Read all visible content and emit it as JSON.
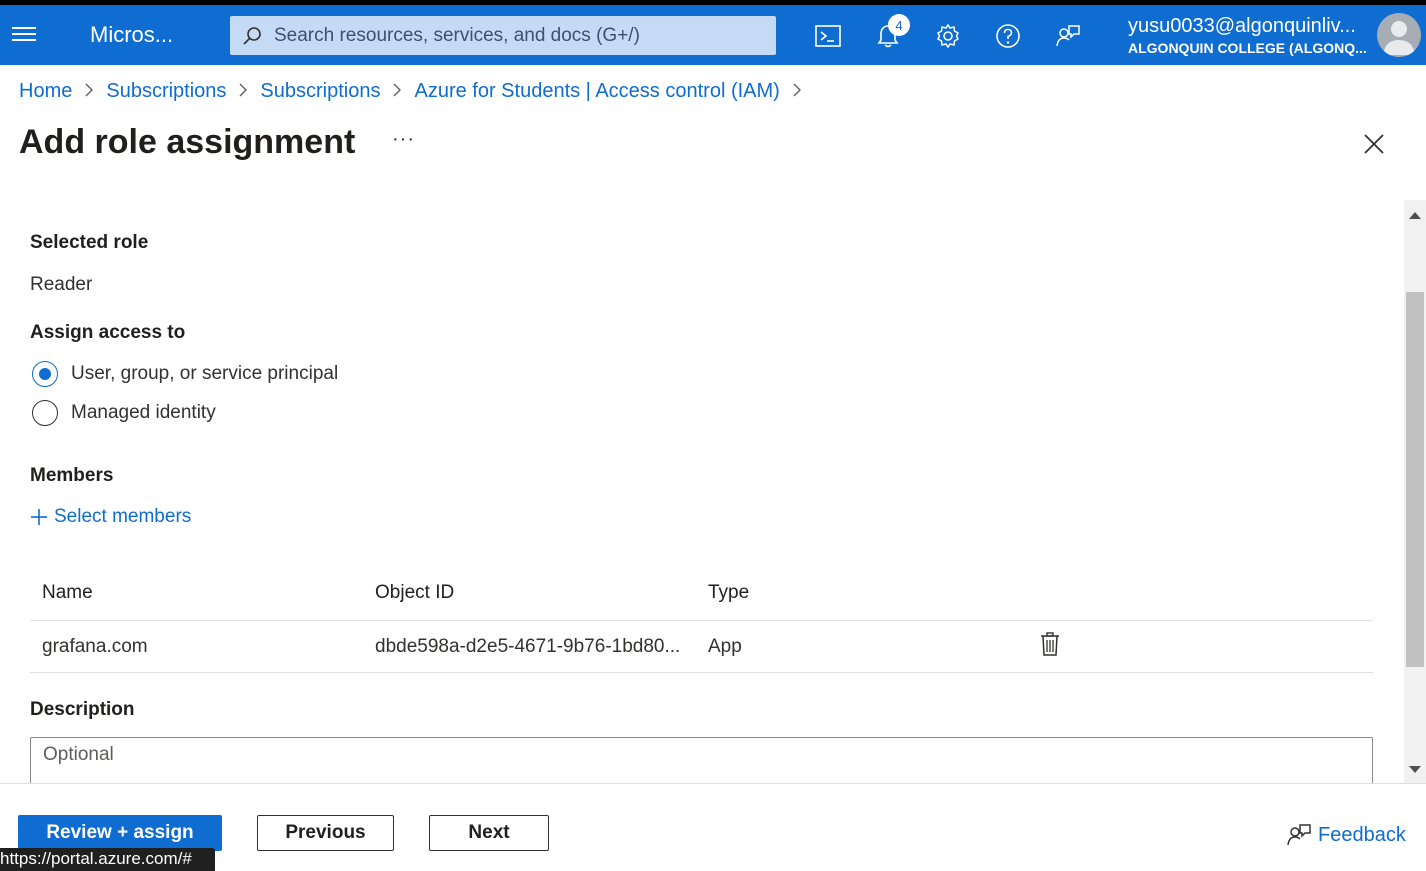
{
  "topbar": {
    "brand": "Micros...",
    "search_placeholder": "Search resources, services, and docs (G+/)",
    "notifications_count": "4",
    "user_email": "yusu0033@algonquinliv...",
    "user_tenant": "ALGONQUIN COLLEGE (ALGONQ..."
  },
  "breadcrumb": [
    "Home",
    "Subscriptions",
    "Subscriptions",
    "Azure for Students | Access control (IAM)"
  ],
  "page": {
    "title": "Add role assignment",
    "more": "···"
  },
  "form": {
    "selected_role_label": "Selected role",
    "selected_role_value": "Reader",
    "assign_access_label": "Assign access to",
    "option_user": "User, group, or service principal",
    "option_managed": "Managed identity",
    "members_label": "Members",
    "select_members": "Select members",
    "table": {
      "headers": [
        "Name",
        "Object ID",
        "Type"
      ],
      "rows": [
        {
          "name": "grafana.com",
          "object_id": "dbde598a-d2e5-4671-9b76-1bd80...",
          "type": "App"
        }
      ]
    },
    "description_label": "Description",
    "description_placeholder": "Optional"
  },
  "footer": {
    "review_assign": "Review + assign",
    "previous": "Previous",
    "next": "Next",
    "feedback": "Feedback"
  },
  "status_url": "https://portal.azure.com/#",
  "colors": {
    "accent": "#0f6cd0",
    "topbar": "#0f6cd0",
    "text": "#323130"
  }
}
